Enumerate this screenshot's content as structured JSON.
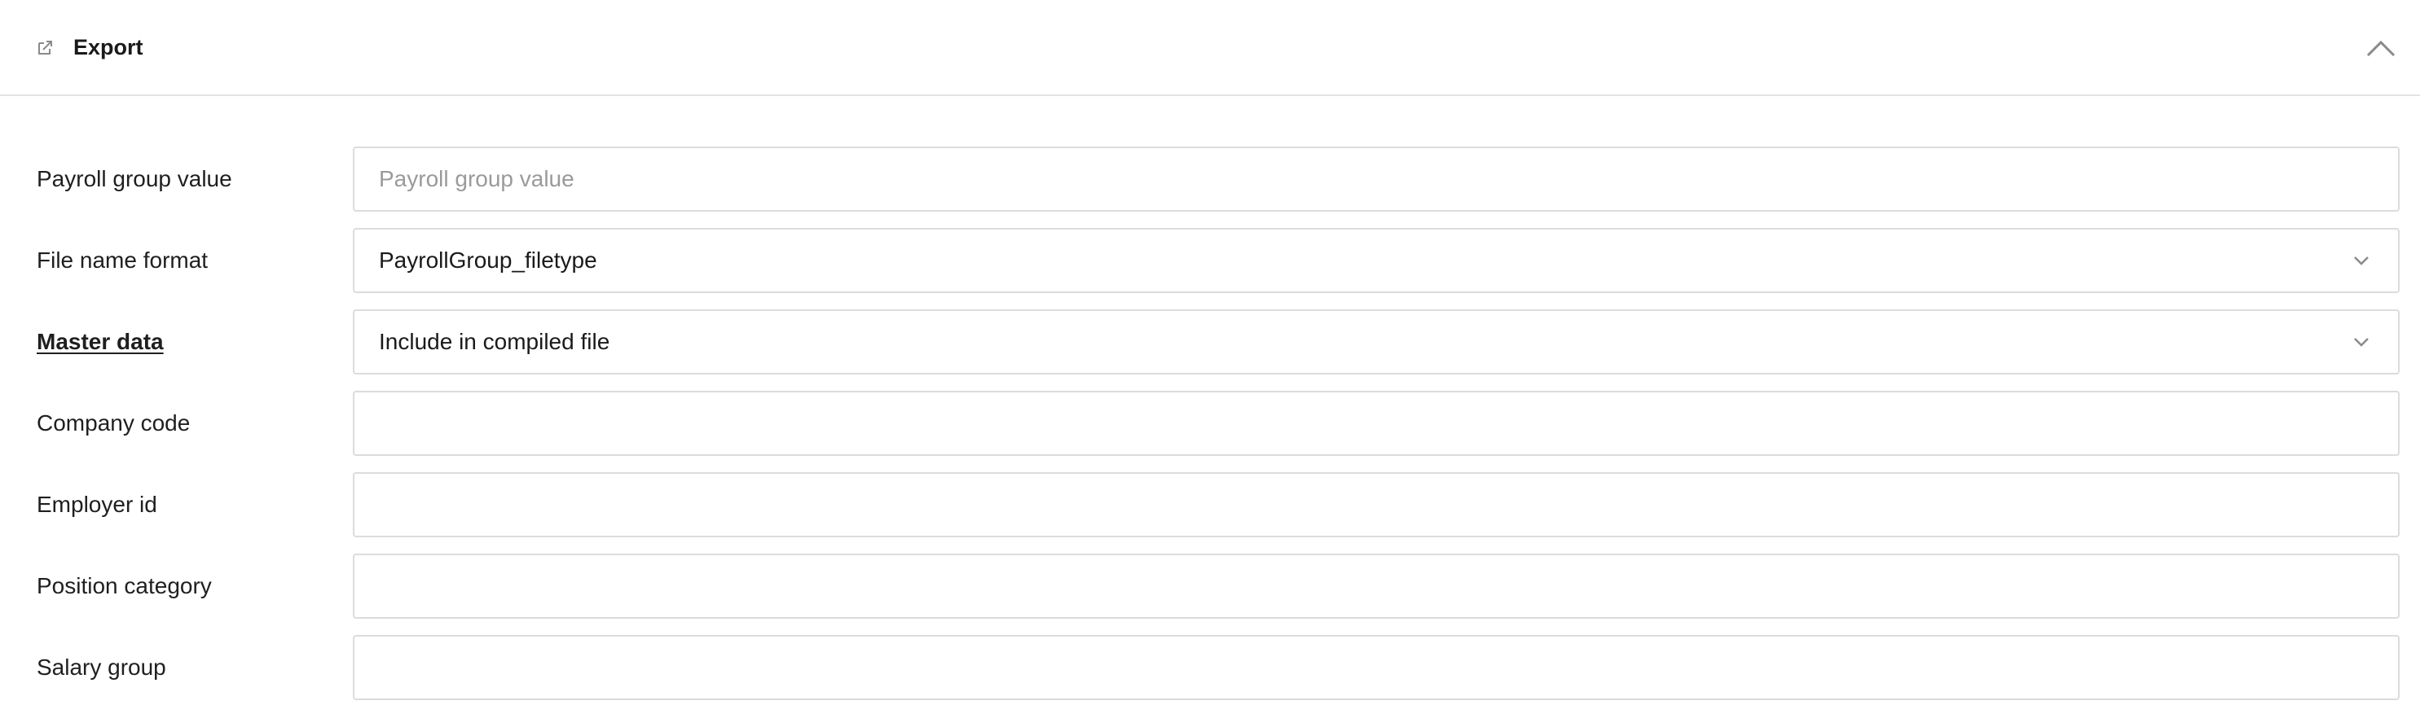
{
  "header": {
    "title": "Export",
    "icon": "export-icon",
    "collapse_icon": "chevron-up-icon"
  },
  "form": {
    "payroll_group_value": {
      "label": "Payroll group value",
      "value": "",
      "placeholder": "Payroll group value"
    },
    "file_name_format": {
      "label": "File name format",
      "selected": "PayrollGroup_filetype"
    },
    "master_data": {
      "label": "Master data",
      "selected": "Include in compiled file"
    },
    "company_code": {
      "label": "Company code",
      "value": ""
    },
    "employer_id": {
      "label": "Employer id",
      "value": ""
    },
    "position_category": {
      "label": "Position category",
      "value": ""
    },
    "salary_group": {
      "label": "Salary group",
      "value": ""
    }
  },
  "colors": {
    "border": "#dcdcdc",
    "divider": "#e3e3e3",
    "text": "#1a1a1a",
    "placeholder": "#9a9a9a",
    "icon": "#8a8a8a"
  }
}
